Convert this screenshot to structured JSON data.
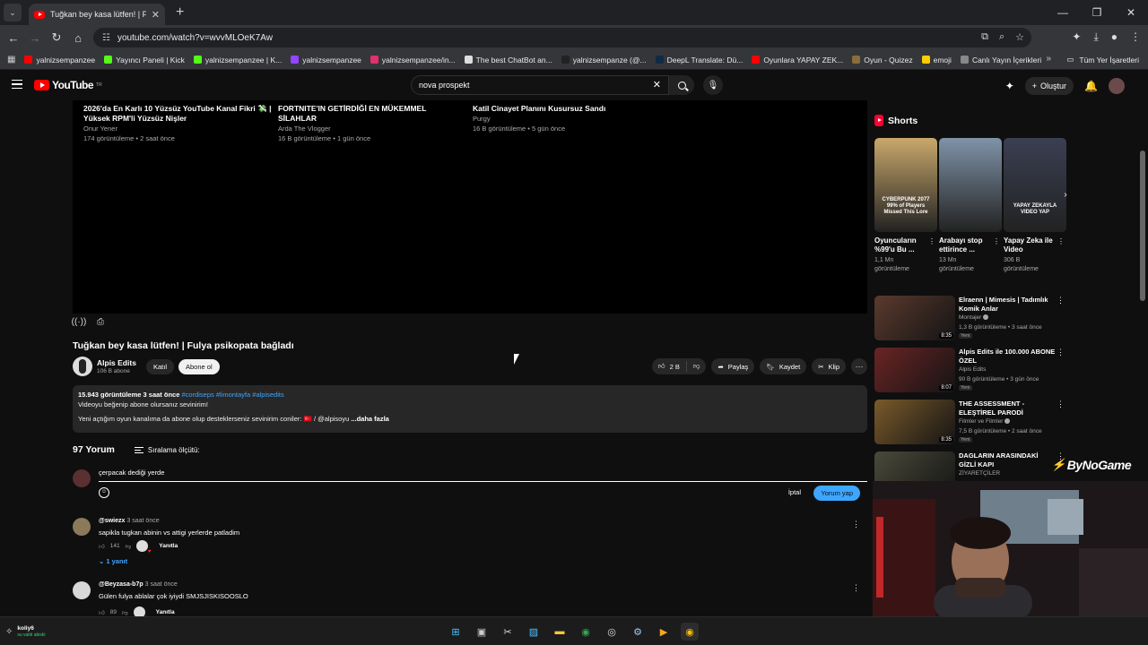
{
  "browser": {
    "tab_title": "Tuğkan bey kasa lütfen! | Fulya",
    "url": "youtube.com/watch?v=wvvMLOeK7Aw",
    "bookmarks": [
      {
        "label": "yalnizsempanzee",
        "color": "#ff0000"
      },
      {
        "label": "Yayıncı Paneli | Kick",
        "color": "#53fc18"
      },
      {
        "label": "yalnizsempanzee | K...",
        "color": "#53fc18"
      },
      {
        "label": "yalnizsempanzee",
        "color": "#9146ff"
      },
      {
        "label": "yalnizsempanzee/in...",
        "color": "#e1306c"
      },
      {
        "label": "The best ChatBot an...",
        "color": "#dddddd"
      },
      {
        "label": "yalnizsempanze (@...",
        "color": "#222222"
      },
      {
        "label": "DeepL Translate: Dü...",
        "color": "#0f2b46"
      },
      {
        "label": "Oyunlara YAPAY ZEK...",
        "color": "#ff0000"
      },
      {
        "label": "Oyun - Quizez",
        "color": "#8a6d3b"
      },
      {
        "label": "emoji",
        "color": "#ffcc00"
      },
      {
        "label": "Canlı Yayın İçerikleri",
        "color": "#888888"
      }
    ],
    "bookmarks_right": "Tüm Yer İşaretleri"
  },
  "header": {
    "logo": "YouTube",
    "logo_suffix": "TR",
    "search_value": "nova prospekt",
    "create_label": "Oluştur"
  },
  "end_cards": [
    {
      "title": "2026'da En Karlı 10 Yüzsüz YouTube Kanal Fikri 💸 | Yüksek RPM'li Yüzsüz Nişler",
      "channel": "Onur Yener",
      "meta": "174 görüntüleme • 2 saat önce"
    },
    {
      "title": "FORTNITE'IN GETİRDİĞİ EN MÜKEMMEL SİLAHLAR",
      "channel": "Arda The Vlogger",
      "meta": "16 B görüntüleme • 1 gün önce"
    },
    {
      "title": "Katil Cinayet Planını Kusursuz Sandı",
      "channel": "Purgy",
      "meta": "16 B görüntüleme • 5 gün önce"
    }
  ],
  "video": {
    "title": "Tuğkan bey kasa lütfen! | Fulya psikopata bağladı",
    "channel": "Alpis Edits",
    "subscribers": "106 B abone",
    "join_label": "Katıl",
    "subscribe_label": "Abone ol",
    "likes": "2 B",
    "share_label": "Paylaş",
    "save_label": "Kaydet",
    "clip_label": "Klip"
  },
  "description": {
    "stats": "15.943 görüntüleme  3 saat önce",
    "tags": "#cordiseps #limontayfa #alpisedits",
    "line1": "Videoyu beğenip abone olursanız sevinirim!",
    "line2": "Yeni açtığım oyun kanalıma da abone olup desteklerseniz sevinirim coniler: 🇹🇷 / @alpisoyu",
    "more": "...daha fazla"
  },
  "comments": {
    "count": "97 Yorum",
    "sort_label": "Sıralama ölçütü:",
    "draft": "çerpacak dediği yerde",
    "cancel_label": "İptal",
    "submit_label": "Yorum yap",
    "reply_label": "Yanıtla",
    "items": [
      {
        "author": "@swiezx",
        "time": "3 saat önce",
        "text": "sapikla tugkan abinin vs attigi yerlerde patladim",
        "likes": "141",
        "replies": "1 yanıt",
        "avatar_color": "#8a7a5a"
      },
      {
        "author": "@Beyzasa-b7p",
        "time": "3 saat önce",
        "text": "Gülen fulya ablalar çok iyiydi SMJSJISKISOOSLO",
        "likes": "89",
        "avatar_color": "#d8d8d8"
      }
    ]
  },
  "sidebar": {
    "shorts_title": "Shorts",
    "shorts": [
      {
        "title": "Oyuncuların %99'u Bu ...",
        "views": "1,1 Mn görüntüleme",
        "caption": "CYBERPUNK 2077 99% of Players Missed This Lore",
        "color": "#c9a86b"
      },
      {
        "title": "Arabayı stop ettirince ...",
        "views": "13 Mn görüntüleme",
        "caption": "",
        "color": "#7f93a8"
      },
      {
        "title": "Yapay Zeka ile Video",
        "views": "306 B görüntüleme",
        "caption": "YAPAY ZEKAYLA VIDEO YAP",
        "color": "#3a3f52"
      }
    ],
    "related": [
      {
        "title": "Elraenn | Mimesis | Tadımlık Komik Anlar",
        "channel": "Montajer",
        "verified": true,
        "meta": "1,3 B görüntüleme • 3 saat önce",
        "new": "Yeni",
        "duration": "8:35",
        "color": "#5b3a2e"
      },
      {
        "title": "Alpis Edits ile 100.000 ABONE ÖZEL",
        "channel": "Alpis Edits",
        "verified": false,
        "meta": "90 B görüntüleme • 3 gün önce",
        "new": "Yeni",
        "duration": "8:07",
        "color": "#6b2424"
      },
      {
        "title": "THE ASSESSMENT - ELEŞTİREL PARODİ",
        "channel": "Filmler ve Filmler",
        "verified": true,
        "meta": "7,5 B görüntüleme • 2 saat önce",
        "new": "Yeni",
        "duration": "8:35",
        "color": "#7a5a2a"
      },
      {
        "title": "DAGLARIN ARASINDAKİ GİZLİ KAPI",
        "channel": "ZİYARETÇİLER",
        "verified": false,
        "meta": "",
        "new": "",
        "duration": "",
        "color": "#4a4a3a"
      }
    ]
  },
  "overlay": {
    "watermark": "ByNoGame"
  },
  "taskbar": {
    "user": "koliy6",
    "status": "su vakti abiski"
  }
}
